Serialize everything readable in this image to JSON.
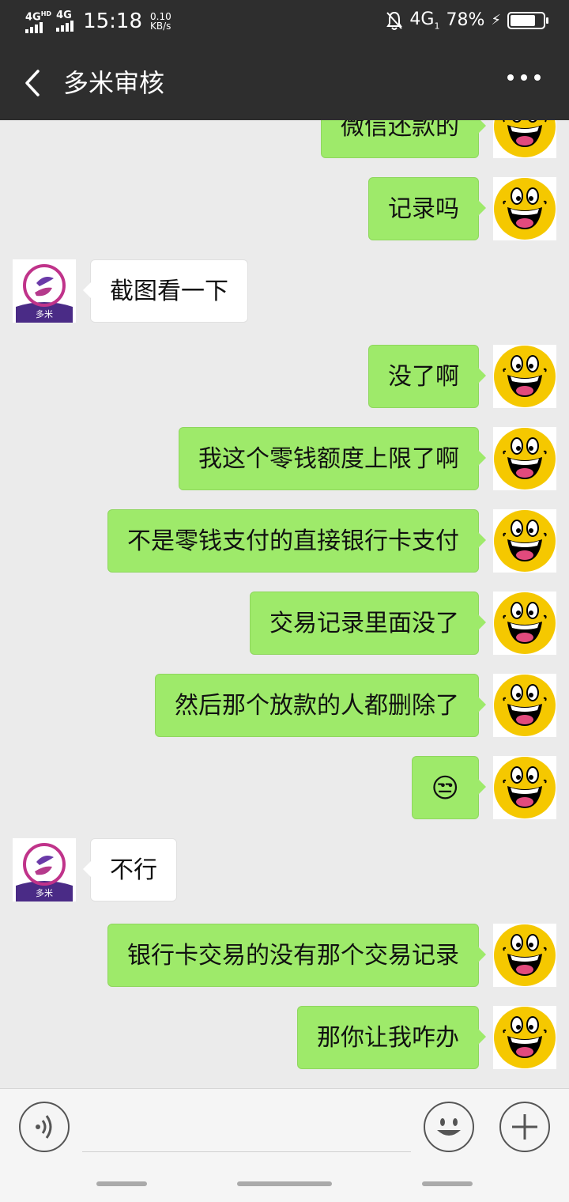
{
  "status_bar": {
    "net1": "4G",
    "net1_sup": "HD",
    "net2": "4G",
    "time": "15:18",
    "speed_value": "0.10",
    "speed_unit": "KB/s",
    "net3": "4G",
    "net3_sub": "1",
    "battery": "78%",
    "battery_level": 0.78
  },
  "header": {
    "title": "多米审核",
    "back_icon": "chevron-left-icon",
    "more_icon": "more-dots-icon"
  },
  "messages": [
    {
      "side": "out",
      "text": "微信还款的"
    },
    {
      "side": "out",
      "text": "记录吗"
    },
    {
      "side": "in",
      "text": "截图看一下",
      "avatar_text": "多米"
    },
    {
      "side": "out",
      "text": "没了啊"
    },
    {
      "side": "out",
      "text": "我这个零钱额度上限了啊"
    },
    {
      "side": "out",
      "text": "不是零钱支付的直接银行卡支付"
    },
    {
      "side": "out",
      "text": "交易记录里面没了"
    },
    {
      "side": "out",
      "text": "然后那个放款的人都删除了"
    },
    {
      "side": "out",
      "text": "😒"
    },
    {
      "side": "in",
      "text": "不行",
      "avatar_text": "多米"
    },
    {
      "side": "out",
      "text": "银行卡交易的没有那个交易记录"
    },
    {
      "side": "out",
      "text": "那你让我咋办"
    }
  ],
  "input_bar": {
    "voice_icon": "voice-icon",
    "emoji_icon": "smiley-icon",
    "plus_icon": "plus-icon"
  },
  "colors": {
    "header_bg": "#2e2e2e",
    "chat_bg": "#ebebeb",
    "outgoing_bubble": "#9eea6a",
    "incoming_bubble": "#ffffff"
  }
}
